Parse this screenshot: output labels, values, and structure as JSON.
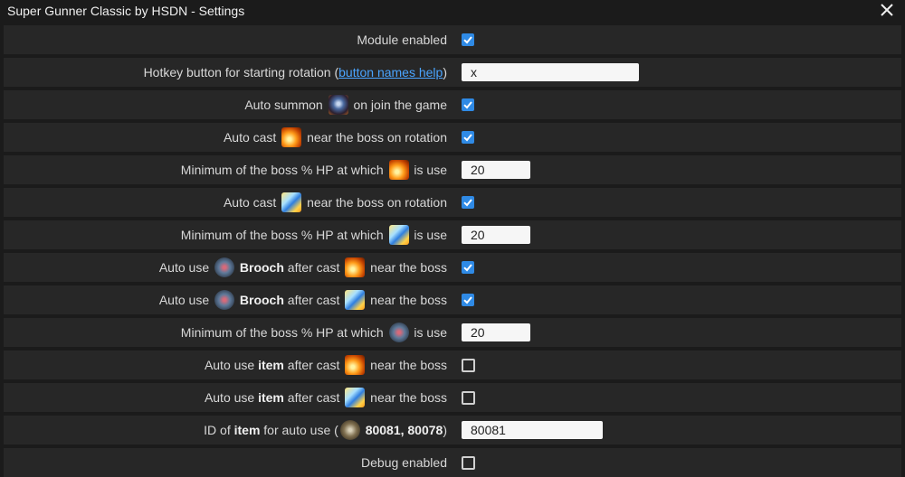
{
  "window": {
    "title": "Super Gunner Classic by HSDN - Settings"
  },
  "rows": {
    "module_enabled": {
      "label": "Module enabled",
      "checked": true
    },
    "hotkey": {
      "prefix": "Hotkey button for starting rotation (",
      "link": "button names help",
      "suffix": ")",
      "value": "x"
    },
    "auto_summon": {
      "prefix": "Auto summon",
      "suffix": "on join the game",
      "checked": true
    },
    "auto_cast_fire": {
      "prefix": "Auto cast",
      "suffix": "near the boss on rotation",
      "checked": true
    },
    "min_hp_fire": {
      "prefix": "Minimum of the boss % HP at which",
      "suffix": "is use",
      "value": "20"
    },
    "auto_cast_bolt": {
      "prefix": "Auto cast",
      "suffix": "near the boss on rotation",
      "checked": true
    },
    "min_hp_bolt": {
      "prefix": "Minimum of the boss % HP at which",
      "suffix": "is use",
      "value": "20"
    },
    "brooch_fire": {
      "prefix": "Auto use",
      "bold": "Brooch",
      "middle": "after cast",
      "suffix": "near the boss",
      "checked": true
    },
    "brooch_bolt": {
      "prefix": "Auto use",
      "bold": "Brooch",
      "middle": "after cast",
      "suffix": "near the boss",
      "checked": true
    },
    "min_hp_brooch": {
      "prefix": "Minimum of the boss % HP at which",
      "suffix": "is use",
      "value": "20"
    },
    "item_fire": {
      "prefix": "Auto use",
      "bold": "item",
      "middle": "after cast",
      "suffix": "near the boss",
      "checked": false
    },
    "item_bolt": {
      "prefix": "Auto use",
      "bold": "item",
      "middle": "after cast",
      "suffix": "near the boss",
      "checked": false
    },
    "item_id": {
      "prefix": "ID of",
      "bold": "item",
      "middle": "for auto use (",
      "ids": "80081, 80078",
      "suffix": ")",
      "value": "80081"
    },
    "debug": {
      "label": "Debug enabled",
      "checked": false
    }
  },
  "icons": [
    "close-icon",
    "summon-icon",
    "fire-skill-icon",
    "bolt-skill-icon",
    "brooch-icon",
    "item-icon"
  ],
  "colors": {
    "background": "#1b1b1b",
    "row": "#272727",
    "checkbox_on": "#2f8ae5",
    "link": "#4aa4ff"
  }
}
